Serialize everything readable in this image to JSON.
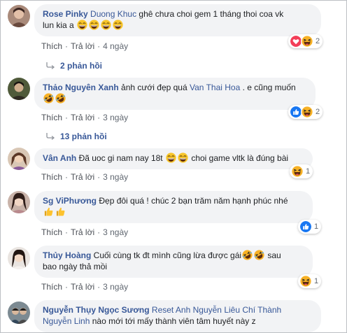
{
  "comments": [
    {
      "author": "Rose Pinky",
      "mention": "Duong Khuc",
      "text1": " ghê chưa choi gem 1 tháng thoi coa vk",
      "text2": "lun kia a ",
      "like": "Thích",
      "reply": "Trả lời",
      "time": "4 ngày",
      "reaction_count": "2",
      "replies": "2 phản hồi"
    },
    {
      "author": "Thảo Nguyên Xanh",
      "text1": " ảnh cưới đẹp quá ",
      "mention": "Van Thai Hoa",
      "text1b": " . e cũng muốn",
      "like": "Thích",
      "reply": "Trả lời",
      "time": "3 ngày",
      "reaction_count": "2",
      "replies": "13 phản hồi"
    },
    {
      "author": "Vân Anh",
      "text1": " Đã uoc gi nam nay 18t ",
      "text1b": " choi game vltk là đúng bài",
      "like": "Thích",
      "reply": "Trả lời",
      "time": "3 ngày",
      "reaction_count": "1"
    },
    {
      "author": "Sg ViPhương",
      "text1": " Đẹp đôi quá ! chúc 2 bạn trăm năm hạnh phúc nhé",
      "like": "Thích",
      "reply": "Trả lời",
      "time": "3 ngày",
      "reaction_count": "1"
    },
    {
      "author": "Thủy Hoàng",
      "text1": " Cuối cùng tk đt mình cũng lừa được gái",
      "text1b": " sau",
      "text2": "bao ngày thả mồi",
      "like": "Thích",
      "reply": "Trả lời",
      "time": "3 ngày",
      "reaction_count": "1"
    },
    {
      "author": "Nguyễn Thụy Ngọc Sương",
      "mention": "Reset Anh Nguyễn",
      "mention2": "Liêu Chí Thành",
      "mention3": "Nguyễn Linh",
      "text2": " nào mới tới mấy thành viên tâm huyết này z"
    }
  ],
  "colors": {
    "link": "#385898",
    "bubble": "#f2f3f5",
    "meta": "#606770",
    "haha": "#f7b125",
    "like": "#1877f2",
    "love": "#f33e58"
  },
  "icons": [
    "haha-emoji-icon",
    "like-reaction-icon",
    "love-reaction-icon",
    "thumbs-up-emoji-icon",
    "reply-arrow-icon"
  ]
}
